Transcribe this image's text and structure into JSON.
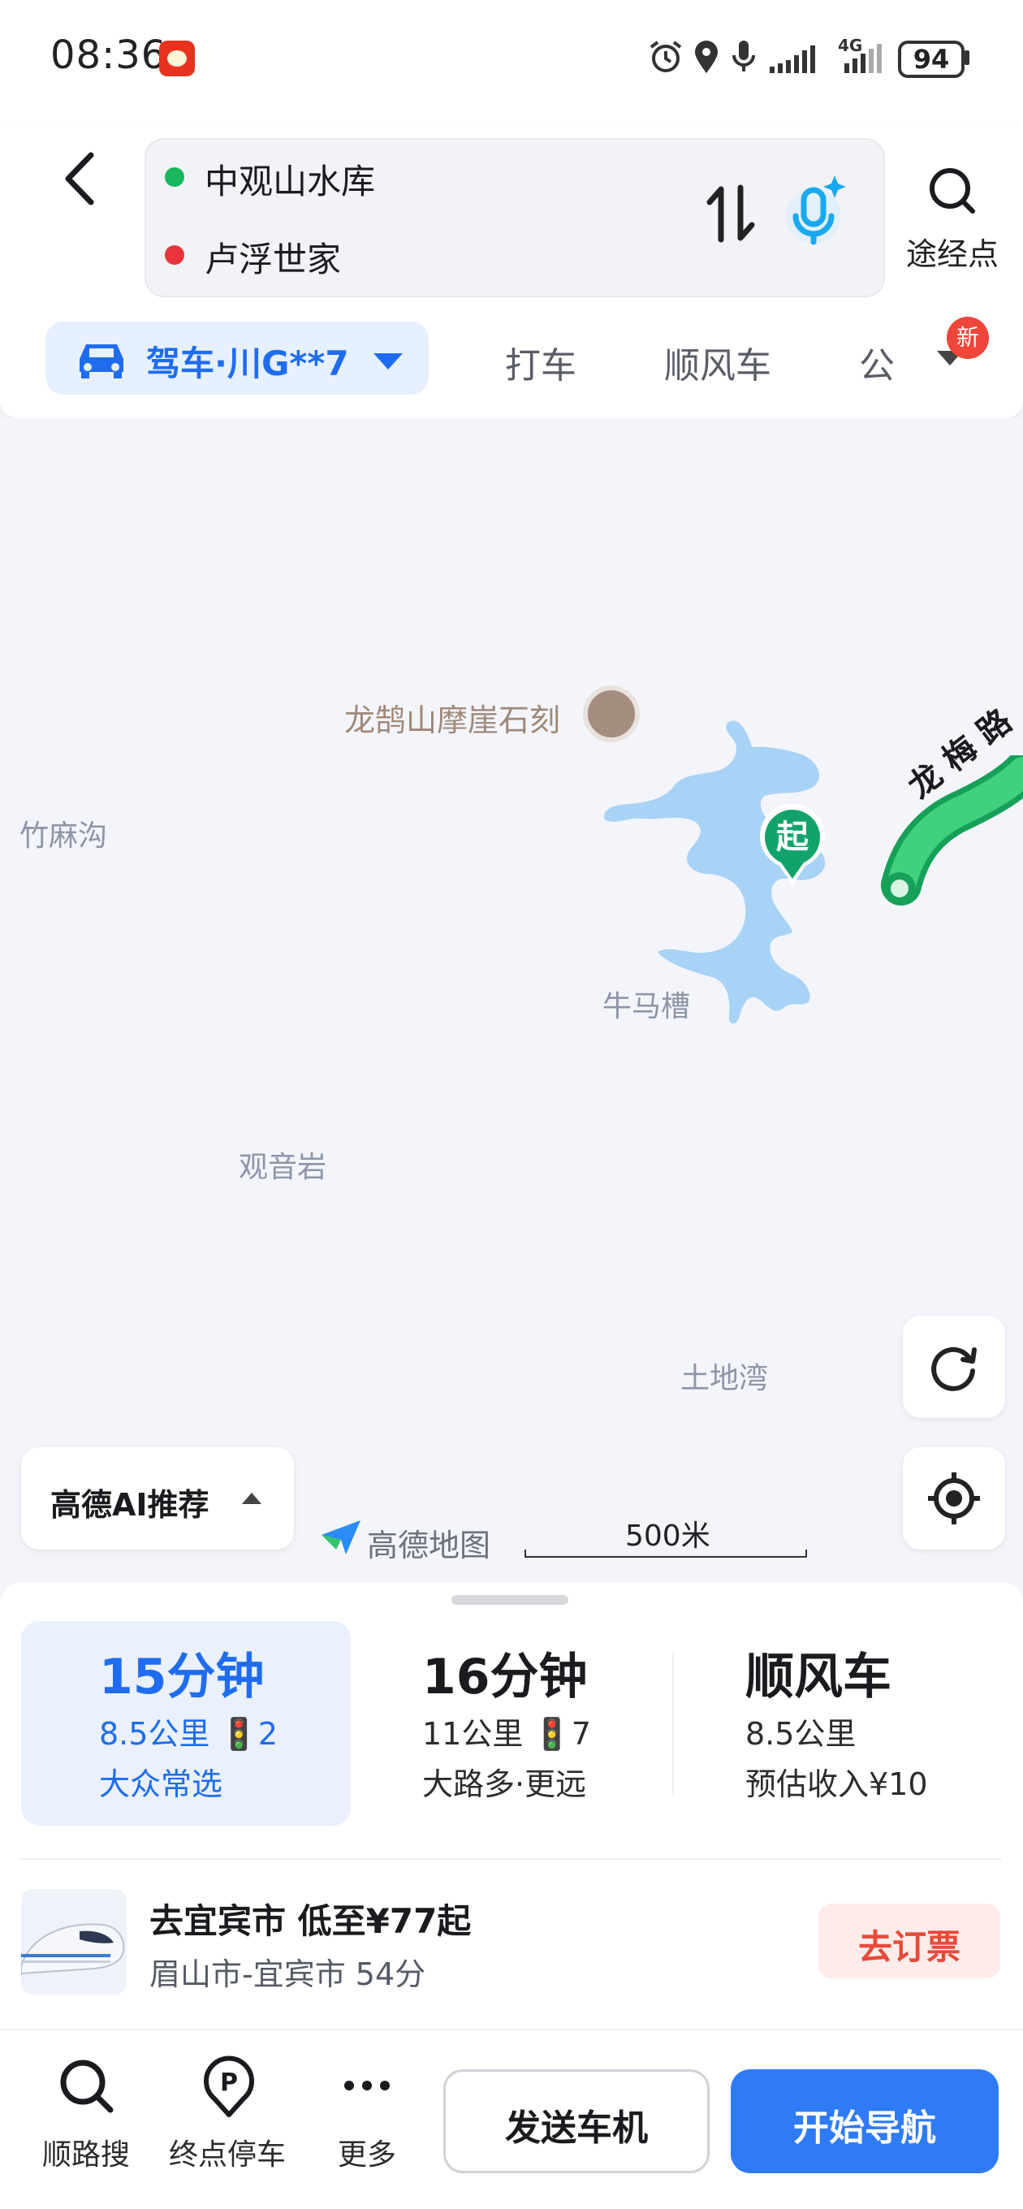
{
  "status_bar": {
    "time": "08:36",
    "battery": "94",
    "network": "4G",
    "icons": [
      "app-badge-icon",
      "alarm-icon",
      "location-icon",
      "mic-icon",
      "signal-icon",
      "signal-4g-icon",
      "battery-icon"
    ]
  },
  "route": {
    "origin": "中观山水库",
    "destination": "卢浮世家",
    "waypoint_label": "途经点",
    "colors": {
      "origin": "#19b760",
      "destination": "#e8343d"
    }
  },
  "transport_tabs": {
    "drive": "驾车·川G**7",
    "taxi": "打车",
    "carpool": "顺风车",
    "bus": "公",
    "new_badge": "新"
  },
  "map": {
    "labels": {
      "poi": "龙鹄山摩崖石刻",
      "zhumagou": "竹麻沟",
      "niumacao": "牛马槽",
      "guanyinyan": "观音岩",
      "tudiwan": "土地湾",
      "road": "龙 梅 路",
      "start_marker": "起"
    },
    "ai_recommend": "高德AI推荐",
    "brand": "高德地图",
    "scale": "500米",
    "colors": {
      "water": "#a9d2f7",
      "route": "#16a058",
      "accent": "#1f6cf0"
    }
  },
  "routes": [
    {
      "time": "15分钟",
      "distance": "8.5公里 🚦2",
      "tag": "大众常选",
      "selected": true
    },
    {
      "time": "16分钟",
      "distance": "11公里 🚦7",
      "tag": "大路多·更远"
    },
    {
      "time": "顺风车",
      "distance": "8.5公里",
      "tag": "预估收入¥10"
    }
  ],
  "ticket": {
    "title": "去宜宾市 低至¥77起",
    "subtitle": "眉山市-宜宾市 54分",
    "button": "去订票"
  },
  "bottom_bar": {
    "along_search": "顺路搜",
    "parking": "终点停车",
    "more": "更多",
    "send_to_car": "发送车机",
    "start_nav": "开始导航"
  }
}
